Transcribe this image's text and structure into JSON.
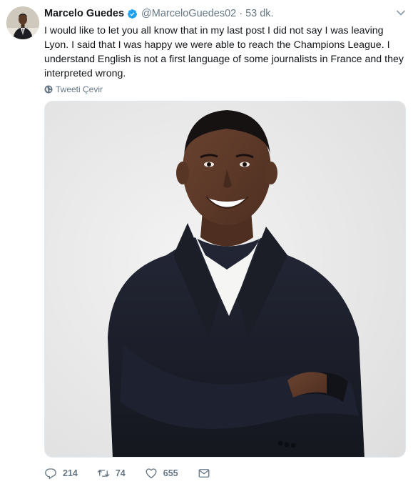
{
  "tweet": {
    "display_name": "Marcelo Guedes",
    "handle": "@MarceloGuedes02",
    "separator": "·",
    "time": "53 dk.",
    "text": "I would like to let you all know that in my last post I did not say I was leaving Lyon. I said that I was happy we were able to reach the Champions League. I understand English is not a first language of some journalists in France and they interpreted wrong.",
    "translate_label": "Tweeti Çevir",
    "verified": true
  },
  "actions": {
    "reply_count": "214",
    "retweet_count": "74",
    "like_count": "655"
  },
  "colors": {
    "verified_blue": "#1da1f2",
    "muted": "#657786",
    "text": "#14171a"
  }
}
